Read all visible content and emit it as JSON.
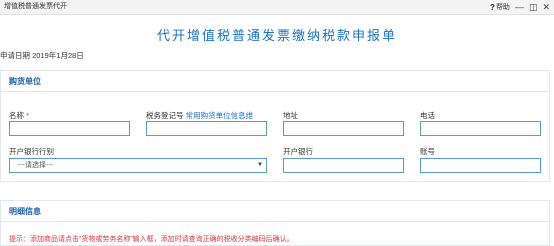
{
  "window": {
    "title": "增值税普通发票代开",
    "help_label": "帮助",
    "help_glyph": "?",
    "minimize_glyph": "—",
    "restore_glyph": "◫",
    "close_glyph": "✕"
  },
  "page": {
    "title": "代开增值税普通发票缴纳税款申报单",
    "apply_date_label": "申请日期",
    "apply_date_value": "2019年1月28日"
  },
  "buyer": {
    "section_title": "购货单位",
    "name_label": "名称",
    "required_mark": "*",
    "tax_id_label": "税务登记号",
    "common_info_link": "常用购货单位信息维",
    "address_label": "地址",
    "phone_label": "电话",
    "bank_type_label": "开户银行行别",
    "bank_type_selected": "---请选择---",
    "bank_label": "开户银行",
    "account_label": "账号",
    "name_value": "",
    "tax_id_value": "",
    "address_value": "",
    "phone_value": "",
    "bank_value": "",
    "account_value": ""
  },
  "detail": {
    "section_title": "明细信息",
    "hint": "提示：添加商品请点击“货物或劳务名称”输入框，添加时请查询正确的税收分类编码后确认。"
  },
  "colors": {
    "accent": "#1b73c6",
    "required": "#d9363e",
    "input_border": "#5b9bd5"
  }
}
